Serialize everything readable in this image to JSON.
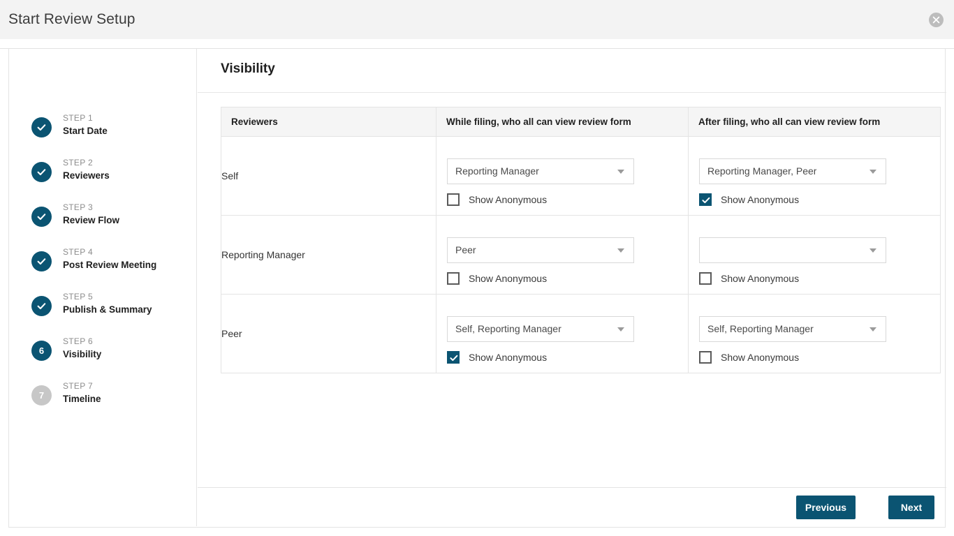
{
  "window": {
    "title": "Start Review Setup",
    "close_icon": "close-icon"
  },
  "theme": {
    "accent": "#0b5472",
    "header_bg": "#f3f3f3",
    "table_header_bg": "#f5f5f5",
    "border": "#e4e4e4",
    "inactive_step": "#c7c7c7"
  },
  "sidebar": {
    "steps": [
      {
        "kicker": "STEP 1",
        "label": "Start Date",
        "state": "complete",
        "marker": "check"
      },
      {
        "kicker": "STEP 2",
        "label": "Reviewers",
        "state": "complete",
        "marker": "check"
      },
      {
        "kicker": "STEP 3",
        "label": "Review Flow",
        "state": "complete",
        "marker": "check"
      },
      {
        "kicker": "STEP 4",
        "label": "Post Review Meeting",
        "state": "complete",
        "marker": "check"
      },
      {
        "kicker": "STEP 5",
        "label": "Publish & Summary",
        "state": "complete",
        "marker": "check"
      },
      {
        "kicker": "STEP 6",
        "label": "Visibility",
        "state": "current",
        "marker": "6"
      },
      {
        "kicker": "STEP 7",
        "label": "Timeline",
        "state": "upcoming",
        "marker": "7"
      }
    ]
  },
  "main": {
    "page_title": "Visibility",
    "table": {
      "headers": [
        "Reviewers",
        "While filing, who all can view review form",
        "After filing, who all can view review form"
      ],
      "rows": [
        {
          "reviewer": "Self",
          "while_filing": {
            "select_value": "Reporting Manager",
            "checkbox_label": "Show Anonymous",
            "checked": false
          },
          "after_filing": {
            "select_value": "Reporting Manager, Peer",
            "checkbox_label": "Show Anonymous",
            "checked": true
          }
        },
        {
          "reviewer": "Reporting Manager",
          "while_filing": {
            "select_value": "Peer",
            "checkbox_label": "Show Anonymous",
            "checked": false
          },
          "after_filing": {
            "select_value": "",
            "checkbox_label": "Show Anonymous",
            "checked": false
          }
        },
        {
          "reviewer": "Peer",
          "while_filing": {
            "select_value": "Self, Reporting Manager",
            "checkbox_label": "Show Anonymous",
            "checked": true
          },
          "after_filing": {
            "select_value": "Self, Reporting Manager",
            "checkbox_label": "Show Anonymous",
            "checked": false
          }
        }
      ]
    }
  },
  "footer": {
    "previous_label": "Previous",
    "next_label": "Next"
  }
}
